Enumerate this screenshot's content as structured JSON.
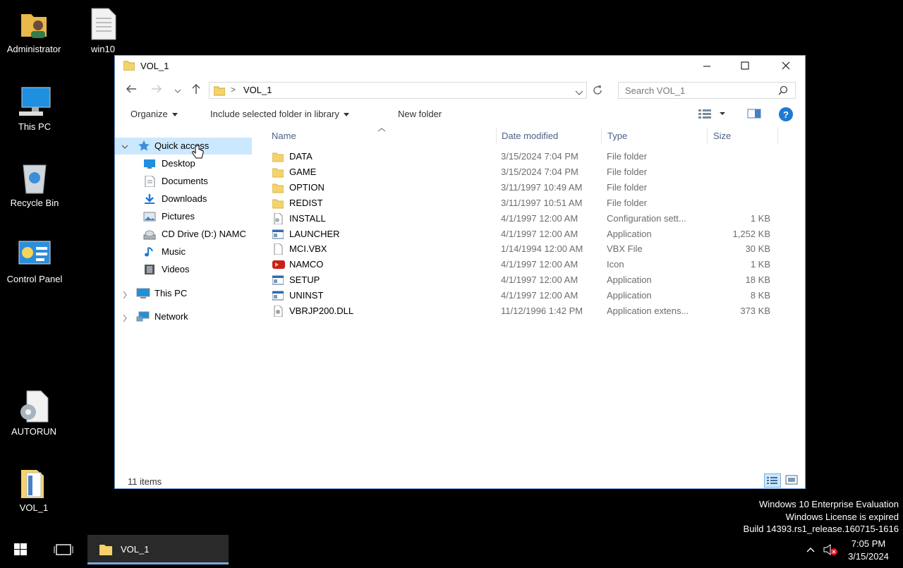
{
  "desktop": {
    "icons": [
      {
        "label": "Administrator"
      },
      {
        "label": "win10"
      },
      {
        "label": "This PC"
      },
      {
        "label": "Recycle Bin"
      },
      {
        "label": "Control Panel"
      },
      {
        "label": "AUTORUN"
      },
      {
        "label": "VOL_1"
      }
    ]
  },
  "window": {
    "title": "VOL_1",
    "address": {
      "separator": ">",
      "path": "VOL_1"
    },
    "search_placeholder": "Search VOL_1",
    "toolbar": {
      "organize": "Organize",
      "include_library": "Include selected folder in library",
      "new_folder": "New folder"
    },
    "nav": {
      "quick_access": "Quick access",
      "items": [
        {
          "label": "Desktop"
        },
        {
          "label": "Documents"
        },
        {
          "label": "Downloads"
        },
        {
          "label": "Pictures"
        },
        {
          "label": "CD Drive (D:) NAMC"
        },
        {
          "label": "Music"
        },
        {
          "label": "Videos"
        }
      ],
      "this_pc": "This PC",
      "network": "Network"
    },
    "columns": {
      "name": "Name",
      "date": "Date modified",
      "type": "Type",
      "size": "Size"
    },
    "files": [
      {
        "name": "DATA",
        "date": "3/15/2024 7:04 PM",
        "type": "File folder",
        "size": "",
        "icon": "folder-icon"
      },
      {
        "name": "GAME",
        "date": "3/15/2024 7:04 PM",
        "type": "File folder",
        "size": "",
        "icon": "folder-icon"
      },
      {
        "name": "OPTION",
        "date": "3/11/1997 10:49 AM",
        "type": "File folder",
        "size": "",
        "icon": "folder-icon"
      },
      {
        "name": "REDIST",
        "date": "3/11/1997 10:51 AM",
        "type": "File folder",
        "size": "",
        "icon": "folder-icon"
      },
      {
        "name": "INSTALL",
        "date": "4/1/1997 12:00 AM",
        "type": "Configuration sett...",
        "size": "1 KB",
        "icon": "config-file-icon"
      },
      {
        "name": "LAUNCHER",
        "date": "4/1/1997 12:00 AM",
        "type": "Application",
        "size": "1,252 KB",
        "icon": "application-icon"
      },
      {
        "name": "MCI.VBX",
        "date": "1/14/1994 12:00 AM",
        "type": "VBX File",
        "size": "30 KB",
        "icon": "blank-file-icon"
      },
      {
        "name": "NAMCO",
        "date": "4/1/1997 12:00 AM",
        "type": "Icon",
        "size": "1 KB",
        "icon": "namco-icon"
      },
      {
        "name": "SETUP",
        "date": "4/1/1997 12:00 AM",
        "type": "Application",
        "size": "18 KB",
        "icon": "application-icon"
      },
      {
        "name": "UNINST",
        "date": "4/1/1997 12:00 AM",
        "type": "Application",
        "size": "8 KB",
        "icon": "application-icon"
      },
      {
        "name": "VBRJP200.DLL",
        "date": "11/12/1996 1:42 PM",
        "type": "Application extens...",
        "size": "373 KB",
        "icon": "dll-file-icon"
      }
    ],
    "status": "11 items"
  },
  "taskbar": {
    "app_label": "VOL_1",
    "time": "7:05 PM",
    "date": "3/15/2024"
  },
  "watermark": {
    "line1": "Windows 10 Enterprise Evaluation",
    "line2": "Windows License is expired",
    "line3": "Build 14393.rs1_release.160715-1616"
  },
  "colors": {
    "selection": "#cce8ff",
    "accent": "#1e7ad2",
    "folder": "#f5d26b"
  }
}
